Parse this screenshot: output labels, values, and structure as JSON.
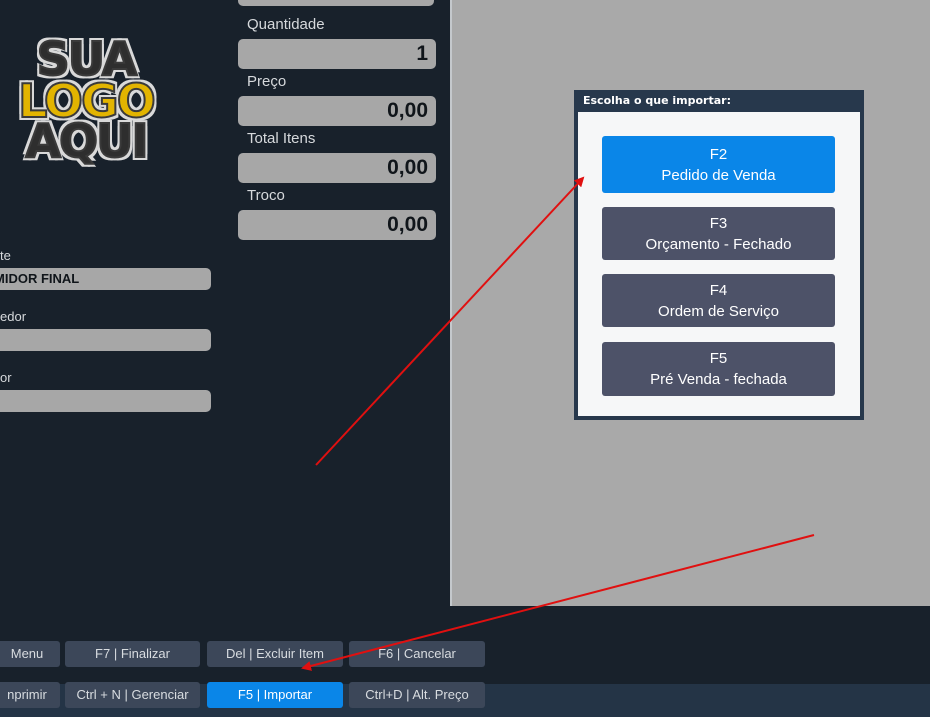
{
  "logo": {
    "line1": "SUA",
    "line2": "LOGO",
    "line3": "AQUI"
  },
  "totals": {
    "quantidade_label": "Quantidade",
    "quantidade_value": "1",
    "preco_label": "Preço",
    "preco_value": "0,00",
    "total_itens_label": "Total Itens",
    "total_itens_value": "0,00",
    "troco_label": "Troco",
    "troco_value": "0,00"
  },
  "customer": {
    "cliente_label": "te",
    "cliente_value": "MIDOR FINAL",
    "vendedor_label": "edor",
    "vendedor_value": "",
    "operador_label": "or",
    "operador_value": ""
  },
  "dialog": {
    "title": "Escolha o que importar:",
    "options": [
      {
        "key": "F2",
        "label": "Pedido de Venda",
        "active": true
      },
      {
        "key": "F3",
        "label": "Orçamento - Fechado",
        "active": false
      },
      {
        "key": "F4",
        "label": "Ordem de Serviço",
        "active": false
      },
      {
        "key": "F5",
        "label": "Pré Venda - fechada",
        "active": false
      }
    ]
  },
  "shortcuts": {
    "row1": [
      "Menu",
      "F7 | Finalizar",
      "Del | Excluir Item",
      "F6 | Cancelar"
    ],
    "row2": [
      "nprimir",
      "Ctrl + N | Gerenciar",
      "F5 | Importar",
      "Ctrl+D | Alt. Preço"
    ]
  },
  "colors": {
    "background": "#18212b",
    "accent": "#0a86e8",
    "annotation_arrow": "#e01010"
  }
}
